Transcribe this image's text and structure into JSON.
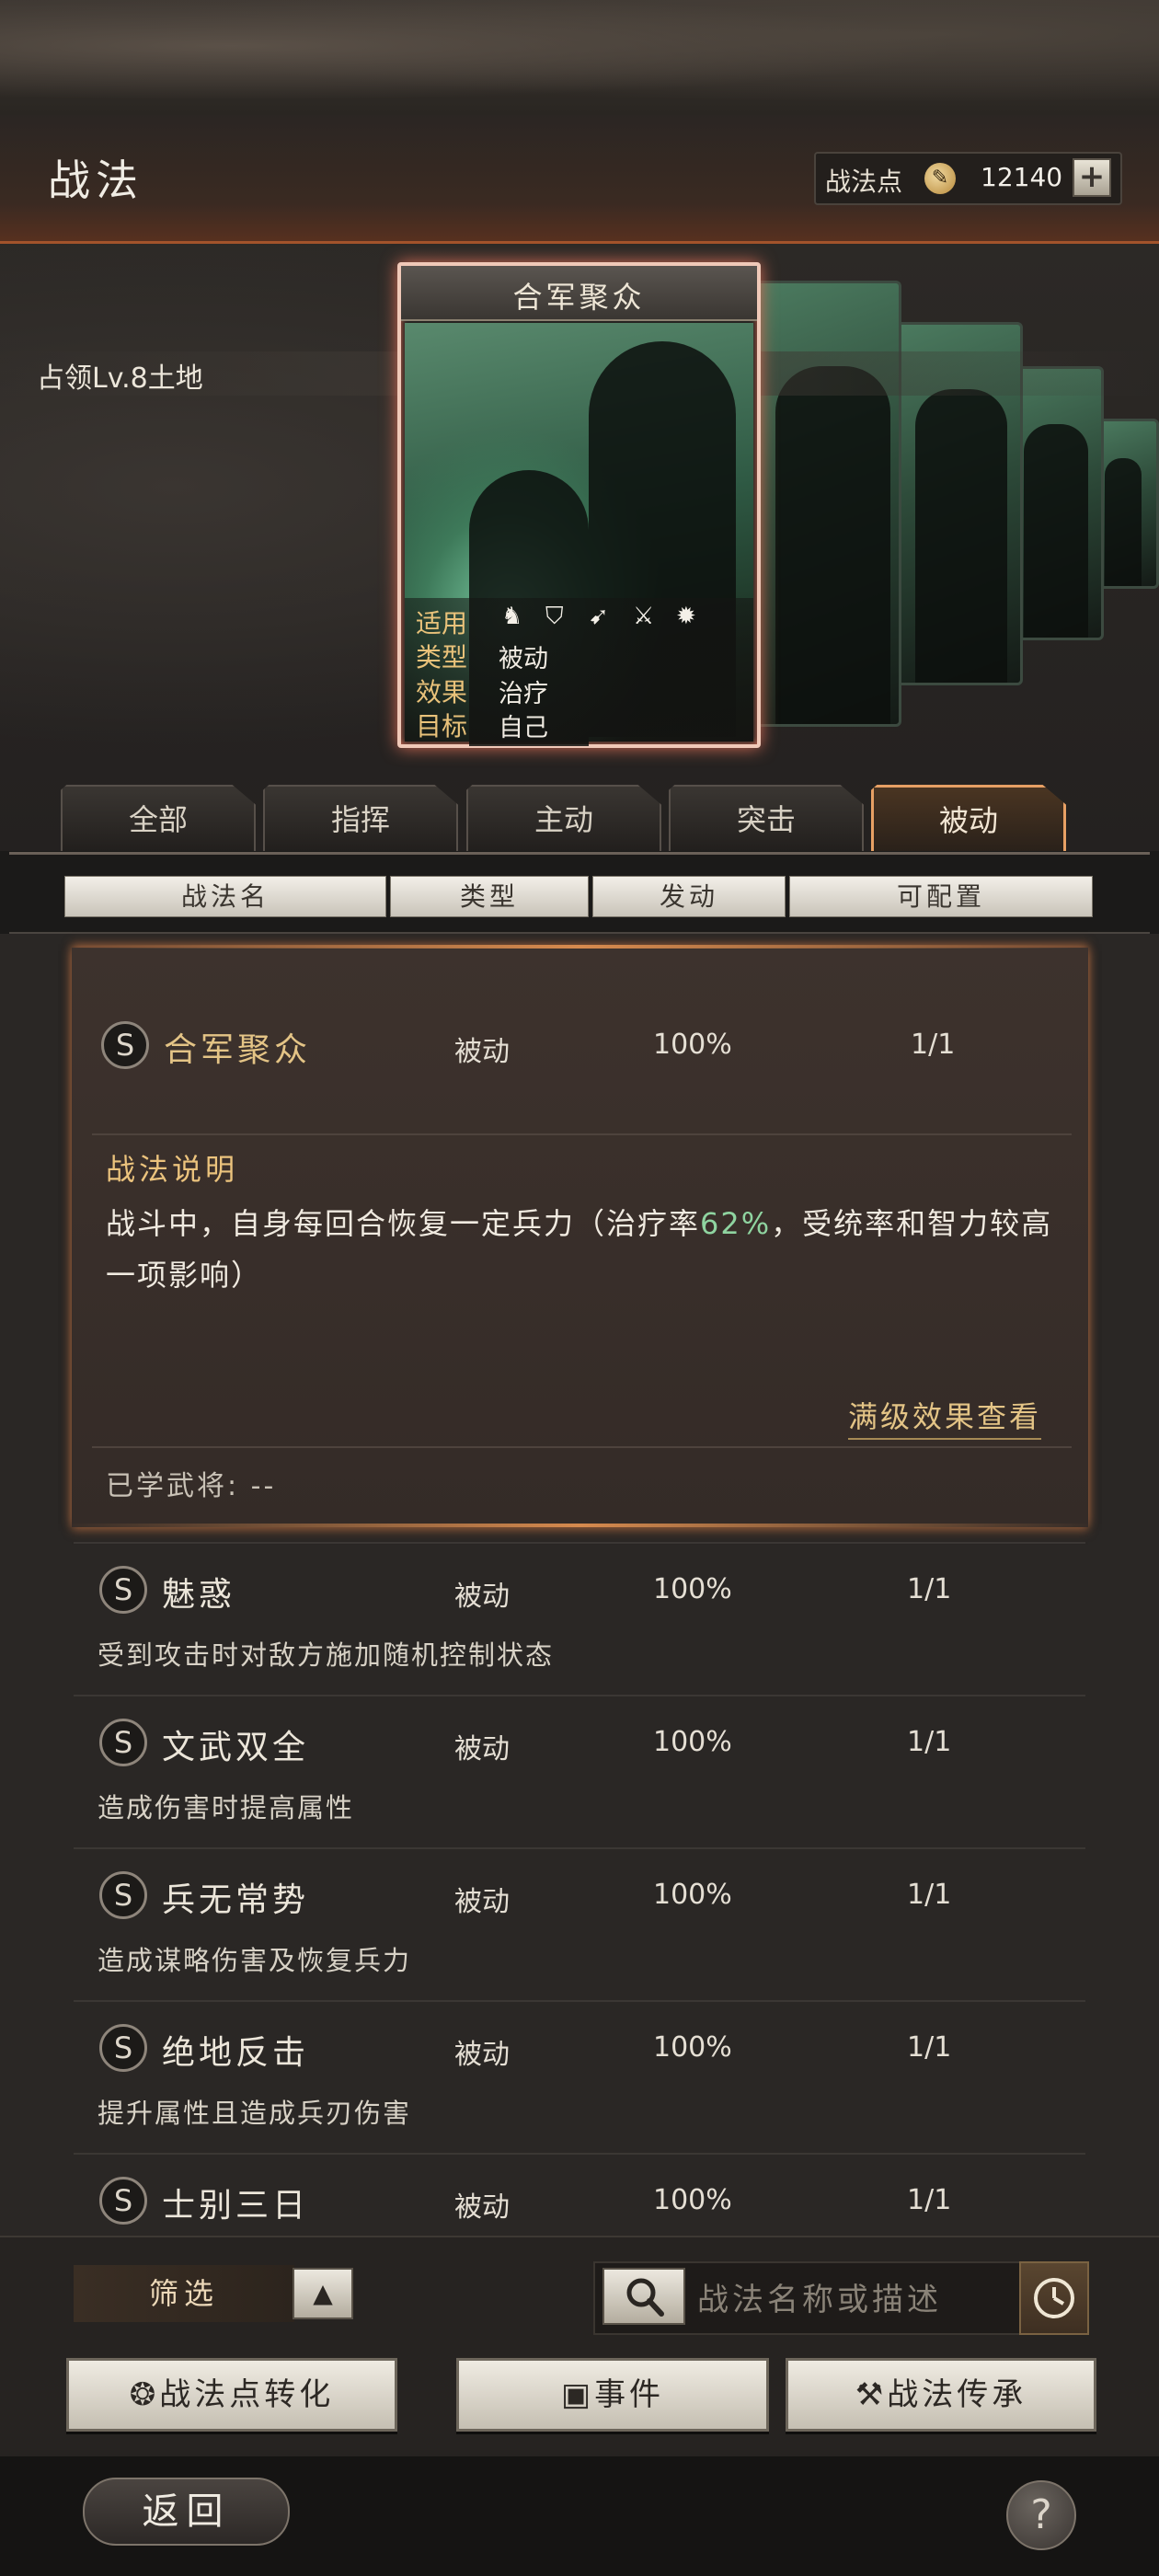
{
  "header": {
    "title": "战法",
    "points_label": "战法点",
    "points_icon": "coin-icon",
    "points_value": "12140",
    "add_label": "+"
  },
  "occupy_text": "占领Lv.8土地",
  "card": {
    "title": "合军聚众",
    "applicable_label": "适用",
    "type_label": "类型",
    "type_value": "被动",
    "effect_label": "效果",
    "effect_value": "治疗",
    "target_label": "目标",
    "target_value": "自己"
  },
  "tabs": [
    {
      "label": "全部"
    },
    {
      "label": "指挥"
    },
    {
      "label": "主动"
    },
    {
      "label": "突击"
    },
    {
      "label": "被动"
    }
  ],
  "columns": {
    "name": "战法名",
    "type": "类型",
    "trigger": "发动",
    "config": "可配置"
  },
  "expanded": {
    "grade": "S",
    "name": "合军聚众",
    "type": "被动",
    "rate": "100%",
    "config": "1/1",
    "desc_title": "战法说明",
    "desc_prefix": "战斗中，自身每回合恢复一定兵力（治疗率",
    "desc_highlight": "62%",
    "desc_suffix": "，受统率和智力较高一项影响）",
    "full_link": "满级效果查看",
    "learned": "已学武将: --"
  },
  "rows": [
    {
      "grade": "S",
      "name": "魅惑",
      "type": "被动",
      "rate": "100%",
      "config": "1/1",
      "desc": "受到攻击时对敌方施加随机控制状态"
    },
    {
      "grade": "S",
      "name": "文武双全",
      "type": "被动",
      "rate": "100%",
      "config": "1/1",
      "desc": "造成伤害时提高属性"
    },
    {
      "grade": "S",
      "name": "兵无常势",
      "type": "被动",
      "rate": "100%",
      "config": "1/1",
      "desc": "造成谋略伤害及恢复兵力"
    },
    {
      "grade": "S",
      "name": "绝地反击",
      "type": "被动",
      "rate": "100%",
      "config": "1/1",
      "desc": "提升属性且造成兵刃伤害"
    },
    {
      "grade": "S",
      "name": "士别三日",
      "type": "被动",
      "rate": "100%",
      "config": "1/1",
      "desc": ""
    }
  ],
  "bottom": {
    "filter_label": "筛选",
    "search_placeholder": "战法名称或描述",
    "convert_label": "战法点转化",
    "event_label": "事件",
    "inherit_label": "战法传承",
    "back_label": "返回",
    "help_label": "?"
  }
}
